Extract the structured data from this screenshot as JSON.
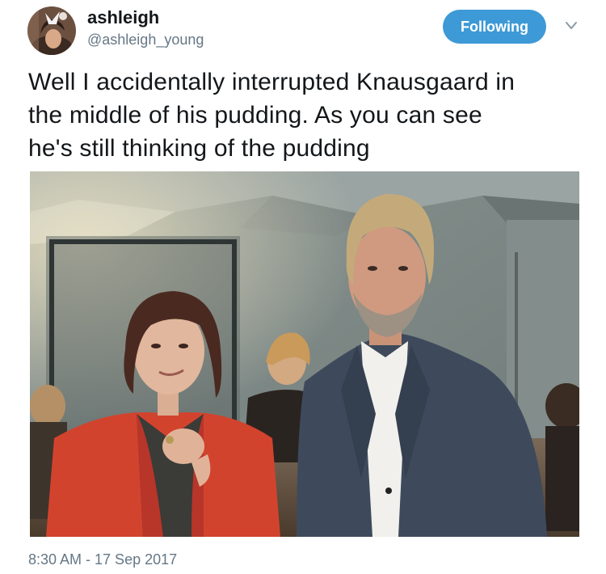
{
  "user": {
    "display_name": "ashleigh",
    "handle": "@ashleigh_young"
  },
  "follow_button": {
    "label": "Following",
    "color": "#3d9ad6"
  },
  "icons": {
    "menu": "chevron-down-icon"
  },
  "tweet": {
    "text_line1": "Well I accidentally interrupted Knausgaard in",
    "text_line2": "the middle of his pudding. As you can see",
    "text_line3": "he's still thinking of the pudding"
  },
  "meta": {
    "timestamp": "8:30 AM - 17 Sep 2017"
  }
}
